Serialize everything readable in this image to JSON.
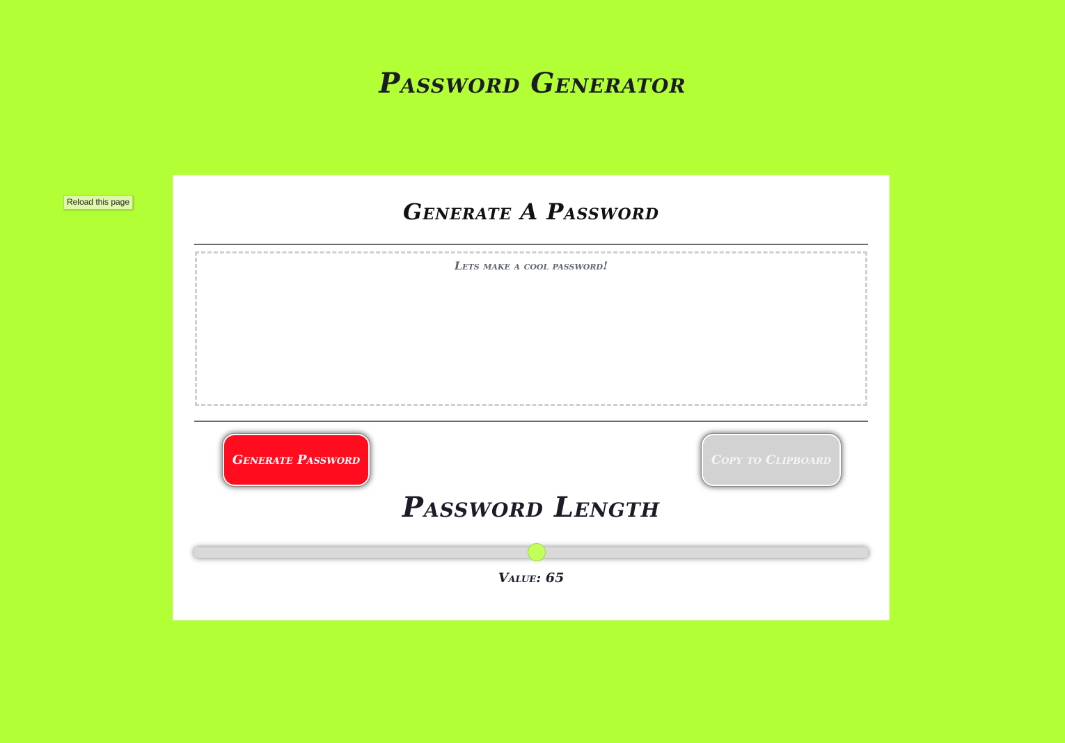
{
  "header": {
    "title": "Password Generator"
  },
  "tooltip": {
    "reload_label": "Reload this page"
  },
  "card": {
    "title": "Generate A Password",
    "password_placeholder": "Lets make a cool password!",
    "generate_button_label": "Generate Password",
    "copy_button_label": "Copy to Clipboard",
    "length_title": "Password Length"
  },
  "slider": {
    "value_prefix": "Value:",
    "value": 65,
    "min": 0,
    "max": 128,
    "thumb_color": "#c2ff5a"
  },
  "colors": {
    "background": "#b3ff36",
    "generate_button": "#ff0c1f",
    "copy_button_disabled": "#d2d2d2",
    "card": "#ffffff"
  }
}
